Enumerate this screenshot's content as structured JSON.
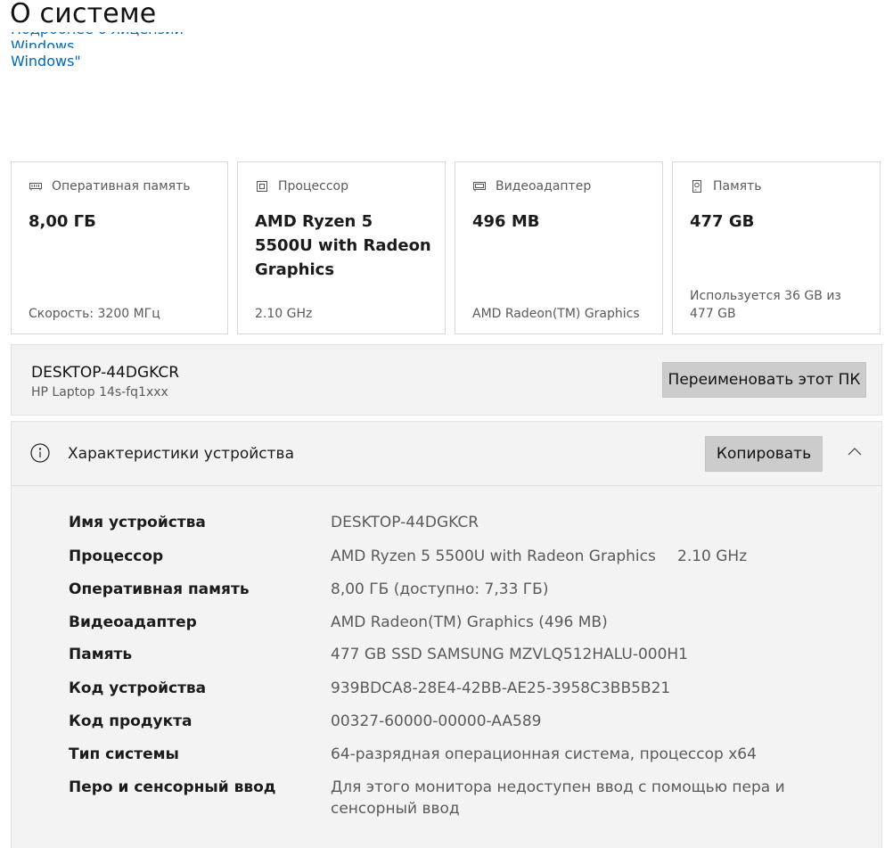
{
  "page": {
    "title": "О системе",
    "link_cut_text": "Подробнее о лицензии Windows",
    "link_text": "Windows\""
  },
  "cards": [
    {
      "icon": "ram-icon",
      "label": "Оперативная память",
      "value": "8,00 ГБ",
      "foot": "Скорость: 3200 МГц"
    },
    {
      "icon": "cpu-icon",
      "label": "Процессор",
      "value": "AMD Ryzen 5 5500U with Radeon Graphics",
      "foot": "2.10 GHz"
    },
    {
      "icon": "gpu-icon",
      "label": "Видеоадаптер",
      "value": "496 MB",
      "foot": "AMD Radeon(TM) Graphics"
    },
    {
      "icon": "storage-icon",
      "label": "Память",
      "value": "477 GB",
      "foot": "Используется 36 GB из 477 GB"
    }
  ],
  "pc": {
    "name": "DESKTOP-44DGKCR",
    "model": "HP Laptop 14s-fq1xxx",
    "rename_label": "Переименовать этот ПК"
  },
  "specs": {
    "title": "Характеристики устройства",
    "copy_label": "Копировать",
    "rows": [
      {
        "key": "Имя устройства",
        "value": "DESKTOP-44DGKCR"
      },
      {
        "key": "Процессор",
        "value": "AMD Ryzen 5 5500U with Radeon Graphics",
        "extra": "2.10 GHz"
      },
      {
        "key": "Оперативная память",
        "value": "8,00 ГБ (доступно: 7,33 ГБ)"
      },
      {
        "key": "Видеоадаптер",
        "value": "AMD Radeon(TM) Graphics (496 MB)"
      },
      {
        "key": "Память",
        "value": "477 GB SSD SAMSUNG MZVLQ512HALU-000H1"
      },
      {
        "key": "Код устройства",
        "value": "939BDCA8-28E4-42BB-AE25-3958C3BB5B21"
      },
      {
        "key": "Код продукта",
        "value": "00327-60000-00000-AA589"
      },
      {
        "key": "Тип системы",
        "value": "64-разрядная операционная система, процессор x64"
      },
      {
        "key": "Перо и сенсорный ввод",
        "value": "Для этого монитора недоступен ввод с помощью пера и сенсорный ввод"
      }
    ]
  },
  "colors": {
    "accent": "#0067c0",
    "panel": "#f3f3f3",
    "button": "#cccccc"
  }
}
